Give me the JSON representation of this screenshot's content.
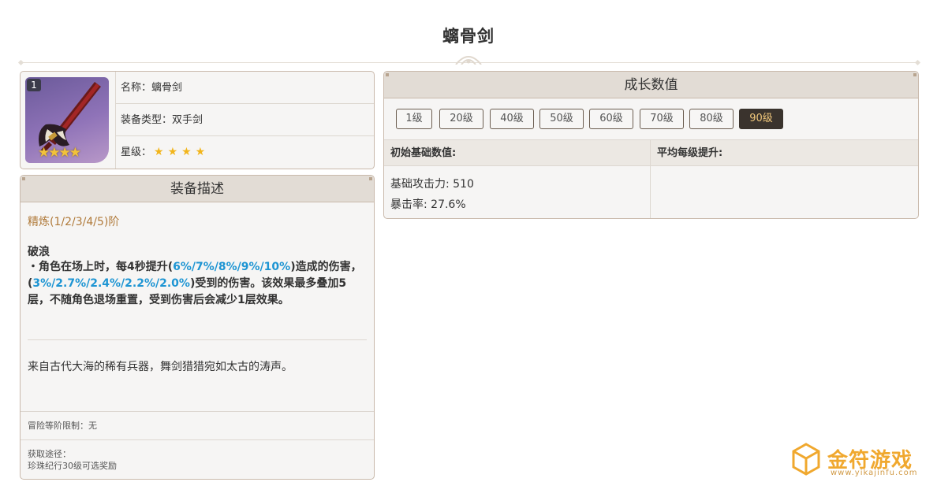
{
  "page": {
    "title": "螭骨剑"
  },
  "info": {
    "badge": "1",
    "stars_overlay": "★★★★",
    "name_label": "名称：",
    "name": "螭骨剑",
    "type_label": "装备类型：",
    "type": "双手剑",
    "rarity_label": "星级：",
    "rarity_stars": "★★★★",
    "rarity": 4
  },
  "desc": {
    "header": "装备描述",
    "refine": "精炼(1/2/3/4/5)阶",
    "skill_name": "破浪",
    "skill_p1": "・角色在场上时，每4秒提升(",
    "skill_h1": "6%/7%/8%/9%/10%",
    "skill_p2": ")造成的伤害，(",
    "skill_h2": "3%/2.7%/2.4%/2.2%/2.0%",
    "skill_p3": ")受到的伤害。该效果最多叠加5层，不随角色退场重置，受到伤害后会减少1层效果。",
    "lore": "来自古代大海的稀有兵器，舞剑猎猎宛如太古的涛声。",
    "limit": "冒险等阶限制：无",
    "source_label": "获取途径：",
    "source": "珍珠纪行30级可选奖励"
  },
  "growth": {
    "header": "成长数值",
    "levels": [
      "1级",
      "20级",
      "40级",
      "50级",
      "60级",
      "70级",
      "80级",
      "90级"
    ],
    "active_level": "90级",
    "col1_header": "初始基础数值:",
    "col2_header": "平均每级提升:",
    "stat1": "基础攻击力: 510",
    "stat2": "暴击率: 27.6%"
  },
  "watermark": {
    "name": "金符游戏",
    "url": "www.yikajinfu.com"
  },
  "colors": {
    "accent_blue": "#1e95d3",
    "refine_brown": "#b07a3a",
    "active_level_bg": "#3a332d",
    "active_level_text": "#f0c77b",
    "panel_head": "#e2dcd5",
    "star_gold": "#f2b51b"
  }
}
